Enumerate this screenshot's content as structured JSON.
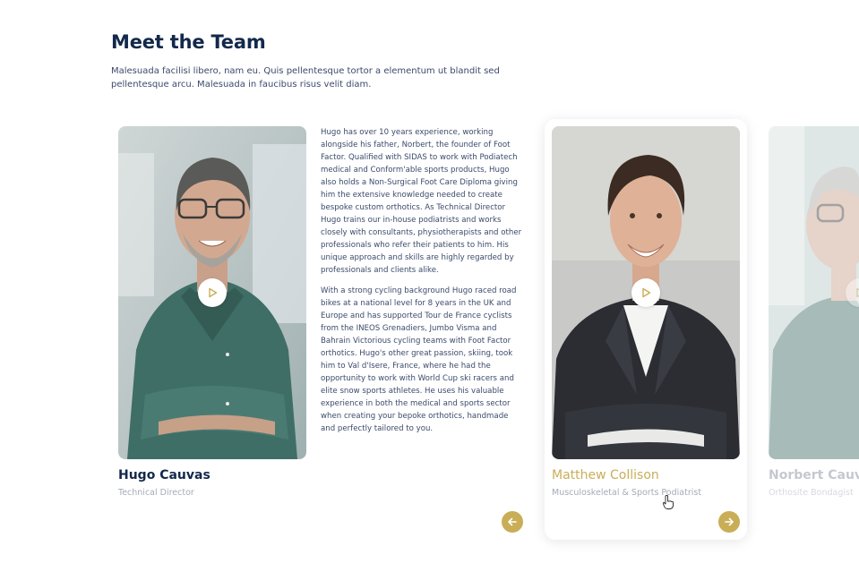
{
  "section": {
    "title": "Meet the Team",
    "intro": "Malesuada facilisi libero, nam eu. Quis pellentesque tortor a elementum ut blandit sed pellentesque arcu. Malesuada in faucibus risus velit diam."
  },
  "members": [
    {
      "name": "Hugo Cauvas",
      "role": "Technical Director",
      "bio": [
        "Hugo has over 10 years experience, working alongside his father, Norbert, the founder of Foot Factor. Qualified with SIDAS to work with Podiatech medical and Conform'able sports products, Hugo also holds a Non-Surgical Foot Care Diploma giving him the extensive knowledge needed to create bespoke custom orthotics. As Technical Director Hugo trains our in-house podiatrists and works closely with consultants, physiotherapists and other professionals who refer their patients to him. His unique approach and skills are highly regarded by professionals and clients alike.",
        "With a strong cycling background Hugo raced road bikes at a national level for 8 years in the UK and Europe and has supported Tour de France cyclists from the INEOS Grenadiers, Jumbo Visma and Bahrain Victorious cycling teams with Foot Factor orthotics. Hugo's other great passion, skiing, took him to Val d'Isere, France, where he had the opportunity to work with World Cup ski racers and elite snow sports athletes. He uses his valuable experience in both the medical and sports sector when creating your bepoke orthotics, handmade and perfectly tailored to you."
      ]
    },
    {
      "name": "Matthew Collison",
      "role": "Musculoskeletal & Sports Podiatrist"
    },
    {
      "name": "Norbert Cauvas",
      "role": "Orthosite Bondagist"
    }
  ],
  "icons": {
    "play": "play-icon",
    "prev": "arrow-left-icon",
    "next": "arrow-right-icon",
    "cursor": "hand-pointer-icon"
  },
  "colors": {
    "heading": "#13294b",
    "accent": "#c9ae57",
    "muted": "#a4abb8",
    "body_text": "#3b4a6b"
  }
}
